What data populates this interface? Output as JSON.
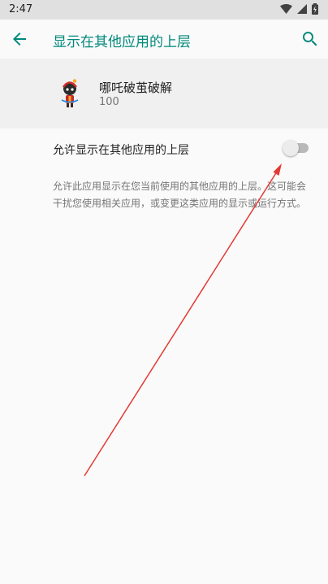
{
  "status_bar": {
    "time": "2:47",
    "icons": [
      "wifi-icon",
      "signal-icon",
      "battery-charging-icon"
    ]
  },
  "app_bar": {
    "title": "显示在其他应用的上层",
    "back_icon": "arrow-back-icon",
    "search_icon": "search-icon",
    "accent_color": "#00897b"
  },
  "app_info": {
    "name": "哪吒破茧破解",
    "version": "100"
  },
  "setting": {
    "label": "允许显示在其他应用的上层",
    "enabled": false
  },
  "description": "允许此应用显示在您当前使用的其他应用的上层。这可能会干扰您使用相关应用，或变更这类应用的显示或运行方式。",
  "annotation": {
    "color": "#e53935",
    "icon": "red-arrow-annotation"
  }
}
